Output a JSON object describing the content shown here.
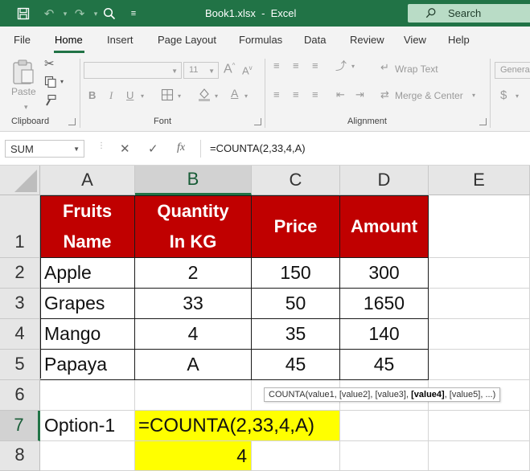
{
  "titlebar": {
    "title": "Book1.xlsx  -  Excel",
    "search_placeholder": "Search"
  },
  "ribbon_tabs": [
    "File",
    "Home",
    "Insert",
    "Page Layout",
    "Formulas",
    "Data",
    "Review",
    "View",
    "Help"
  ],
  "ribbon": {
    "paste_label": "Paste",
    "font_size": "11",
    "wrap_text": "Wrap Text",
    "merge_center": "Merge & Center",
    "number_format": "General",
    "currency_symbol": "$",
    "group_clipboard": "Clipboard",
    "group_font": "Font",
    "group_alignment": "Alignment",
    "bold": "B",
    "italic": "I",
    "underline": "U",
    "grow_font": "A",
    "shrink_font": "A",
    "fill_color_letter": "A"
  },
  "formula_bar": {
    "name_box": "SUM",
    "fx_label": "fx",
    "formula": "=COUNTA(2,33,4,A)"
  },
  "columns": [
    "A",
    "B",
    "C",
    "D",
    "E"
  ],
  "rows": [
    "1",
    "2",
    "3",
    "4",
    "5",
    "6",
    "7",
    "8"
  ],
  "table": {
    "headers": [
      "Fruits Name",
      "Quantity In KG",
      "Price",
      "Amount"
    ],
    "header_lines": [
      [
        "Fruits",
        "Name"
      ],
      [
        "Quantity",
        "In KG"
      ],
      [
        "Price"
      ],
      [
        "Amount"
      ]
    ],
    "rows": [
      [
        "Apple",
        "2",
        "150",
        "300"
      ],
      [
        "Grapes",
        "33",
        "50",
        "1650"
      ],
      [
        "Mango",
        "4",
        "35",
        "140"
      ],
      [
        "Papaya",
        "A",
        "45",
        "45"
      ]
    ]
  },
  "option_row": {
    "label": "Option-1",
    "formula_edit": "=COUNTA(2,33,4,A)",
    "result": "4"
  },
  "tooltip": {
    "before": "COUNTA(value1, [value2], [value3], ",
    "bold": "[value4]",
    "after": ", [value5], ...)"
  },
  "colors": {
    "excel_green": "#217346",
    "header_red": "#c00000",
    "highlight_yellow": "#ffff00"
  }
}
